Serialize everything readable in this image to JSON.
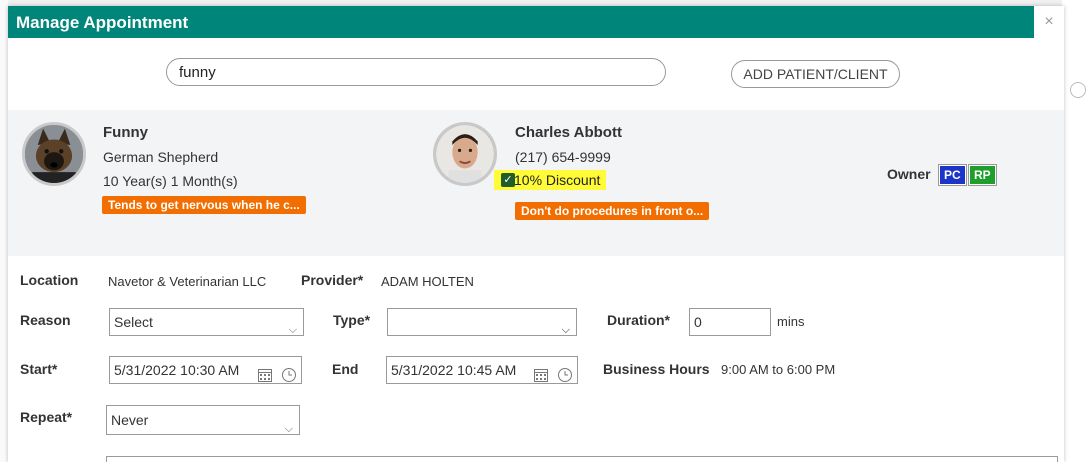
{
  "modal": {
    "title": "Manage Appointment",
    "close_glyph": "×"
  },
  "search": {
    "value": "funny",
    "add_button": "ADD PATIENT/CLIENT"
  },
  "patient": {
    "name": "Funny",
    "breed": "German Shepherd",
    "age": "10 Year(s) 1 Month(s)",
    "alert": "Tends to get nervous when he c..."
  },
  "client": {
    "name": "Charles Abbott",
    "phone": "(217) 654-9999",
    "discount": "10% Discount",
    "alert": "Don't do procedures in front o...",
    "owner_label": "Owner",
    "badges": [
      {
        "label": "PC",
        "color": "#1a35c8"
      },
      {
        "label": "RP",
        "color": "#1e9e2a"
      }
    ]
  },
  "form": {
    "location_label": "Location",
    "location_value": "Navetor & Veterinarian LLC",
    "provider_label": "Provider*",
    "provider_value": "ADAM HOLTEN",
    "reason_label": "Reason",
    "reason_value": "Select",
    "type_label": "Type*",
    "type_value": "",
    "duration_label": "Duration*",
    "duration_value": "0",
    "duration_unit": "mins",
    "start_label": "Start*",
    "start_value": "5/31/2022 10:30 AM",
    "end_label": "End",
    "end_value": "5/31/2022 10:45 AM",
    "business_hours_label": "Business Hours",
    "business_hours_value": "9:00 AM to 6:00 PM",
    "repeat_label": "Repeat*",
    "repeat_value": "Never"
  },
  "colors": {
    "header": "#00857a",
    "alert_tag": "#f26e00",
    "discount_highlight": "#fffb36"
  }
}
